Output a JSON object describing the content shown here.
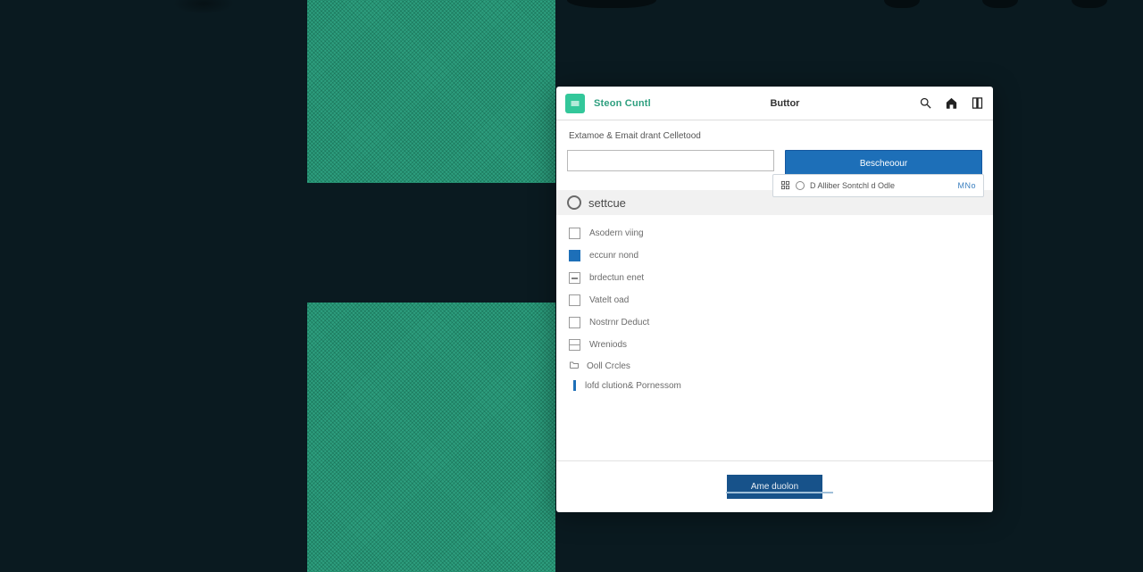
{
  "header": {
    "brand": "Steon Cuntl",
    "title": "Buttor"
  },
  "breadcrumb": "Extamoe & Emait drant Celletood",
  "search": {
    "value": ""
  },
  "primary_button": "Bescheoour",
  "card": {
    "name": "D Alliber Sontchl d Odle",
    "ratio": "MNo"
  },
  "section": {
    "label": "settcue"
  },
  "options": [
    {
      "label": "Asodern viing",
      "state": "unchecked"
    },
    {
      "label": "eccunr nond",
      "state": "checked"
    },
    {
      "label": "brdectun enet",
      "state": "dash"
    },
    {
      "label": "Vatelt oad",
      "state": "unchecked"
    },
    {
      "label": "Nostrnr Deduct",
      "state": "unchecked"
    },
    {
      "label": "Wreniods",
      "state": "split"
    }
  ],
  "links": {
    "folder": "Ooll Crcles",
    "perm": "lofd clution& Pornessom"
  },
  "footer": {
    "button": "Ame duolon"
  }
}
